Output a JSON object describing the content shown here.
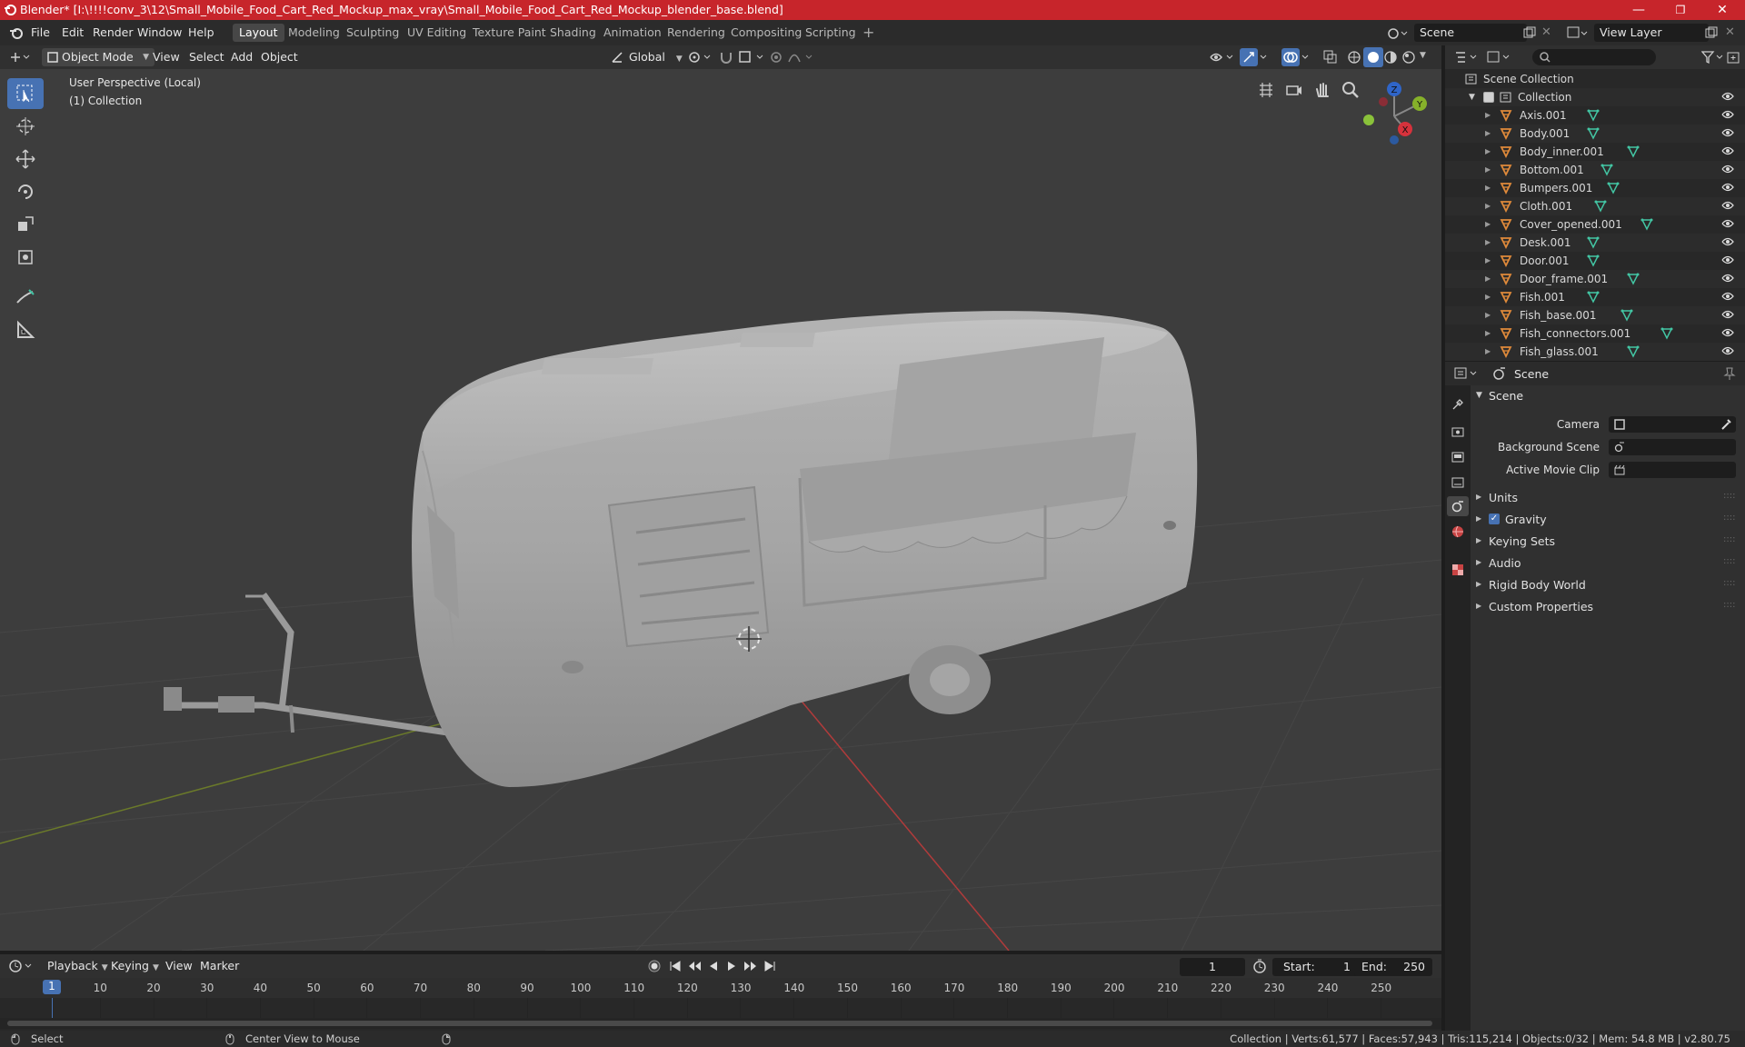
{
  "window": {
    "title": "Blender* [I:\\!!!!conv_3\\12\\Small_Mobile_Food_Cart_Red_Mockup_max_vray\\Small_Mobile_Food_Cart_Red_Mockup_blender_base.blend]",
    "minimize": "—",
    "maximize": "❐",
    "close": "✕"
  },
  "menu": [
    "File",
    "Edit",
    "Render",
    "Window",
    "Help"
  ],
  "workspaces": [
    "Layout",
    "Modeling",
    "Sculpting",
    "UV Editing",
    "Texture Paint",
    "Shading",
    "Animation",
    "Rendering",
    "Compositing",
    "Scripting"
  ],
  "active_workspace": "Layout",
  "scene_field": "Scene",
  "view_layer_field": "View Layer",
  "viewport_header": {
    "mode": "Object Mode",
    "menus": [
      "View",
      "Select",
      "Add",
      "Object"
    ],
    "orientation": "Global"
  },
  "viewport": {
    "perspective_label": "User Perspective (Local)",
    "collection_label": "(1) Collection",
    "gizmo_axes": {
      "x": "X",
      "y": "Y",
      "z": "Z"
    }
  },
  "outliner": {
    "root": "Scene Collection",
    "collection": "Collection",
    "items": [
      "Axis.001",
      "Body.001",
      "Body_inner.001",
      "Bottom.001",
      "Bumpers.001",
      "Cloth.001",
      "Cover_opened.001",
      "Desk.001",
      "Door.001",
      "Door_frame.001",
      "Fish.001",
      "Fish_base.001",
      "Fish_connectors.001",
      "Fish_glass.001"
    ]
  },
  "properties": {
    "header": "Scene",
    "section": "Scene",
    "fields": [
      {
        "label": "Camera"
      },
      {
        "label": "Background Scene"
      },
      {
        "label": "Active Movie Clip"
      }
    ],
    "subsections": [
      "Units",
      "Gravity",
      "Keying Sets",
      "Audio",
      "Rigid Body World",
      "Custom Properties"
    ],
    "gravity_checked": true
  },
  "timeline": {
    "menus": [
      "Playback",
      "Keying",
      "View",
      "Marker"
    ],
    "current_frame": "1",
    "start_label": "Start:",
    "start": "1",
    "end_label": "End:",
    "end": "250",
    "ticks": [
      "1",
      "10",
      "20",
      "30",
      "40",
      "50",
      "60",
      "70",
      "80",
      "90",
      "100",
      "110",
      "120",
      "130",
      "140",
      "150",
      "160",
      "170",
      "180",
      "190",
      "200",
      "210",
      "220",
      "230",
      "240",
      "250"
    ]
  },
  "statusbar": {
    "left": "Select",
    "middle": "Center View to Mouse",
    "right": "Collection | Verts:61,577 | Faces:57,943 | Tris:115,214 | Objects:0/32 | Mem: 54.8 MB | v2.80.75"
  },
  "colors": {
    "title_bar": "#c7252b",
    "accent": "#4772b3",
    "mesh_icon": "#e08a3a",
    "data_icon": "#43c6a4"
  }
}
